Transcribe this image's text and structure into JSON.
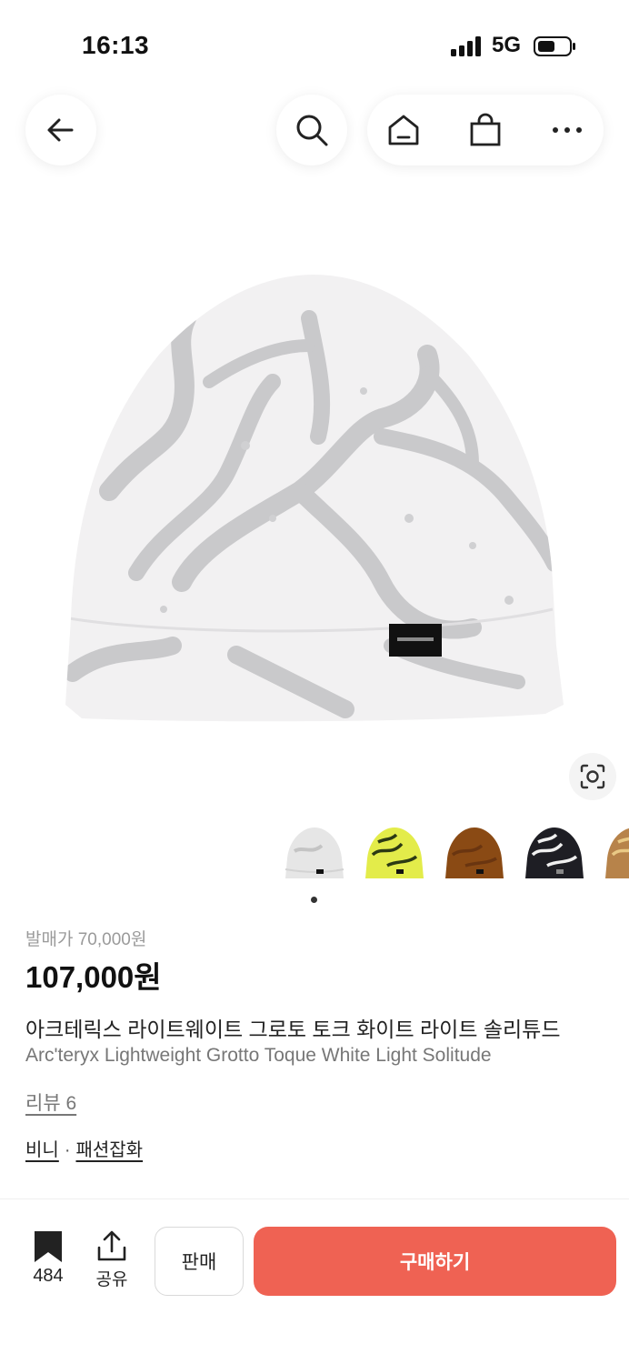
{
  "status_bar": {
    "time": "16:13",
    "network": "5G"
  },
  "nav": {
    "back_icon": "arrow-left-icon",
    "search_icon": "search-icon",
    "home_icon": "home-icon",
    "cart_icon": "shopping-bag-icon",
    "more_icon": "more-horizontal-icon"
  },
  "product": {
    "release_price": "발매가 70,000원",
    "price": "107,000원",
    "name_ko": "아크테릭스 라이트웨이트 그로토 토크 화이트 라이트 솔리튜드",
    "name_en": "Arc'teryx Lightweight Grotto Toque White Light Solitude",
    "review": "리뷰 6",
    "category_primary": "비니",
    "category_separator": "·",
    "category_secondary": "패션잡화",
    "variants": [
      "white",
      "yellow",
      "brown",
      "black",
      "tan"
    ],
    "variant_colors": [
      "#e6e6e6",
      "#e3ec4a",
      "#8a4a14",
      "#1e1e24",
      "#b7834a"
    ]
  },
  "bottom_bar": {
    "bookmark_count": "484",
    "share_label": "공유",
    "sell_label": "판매",
    "buy_label": "구매하기",
    "buy_color": "#ef6253"
  }
}
